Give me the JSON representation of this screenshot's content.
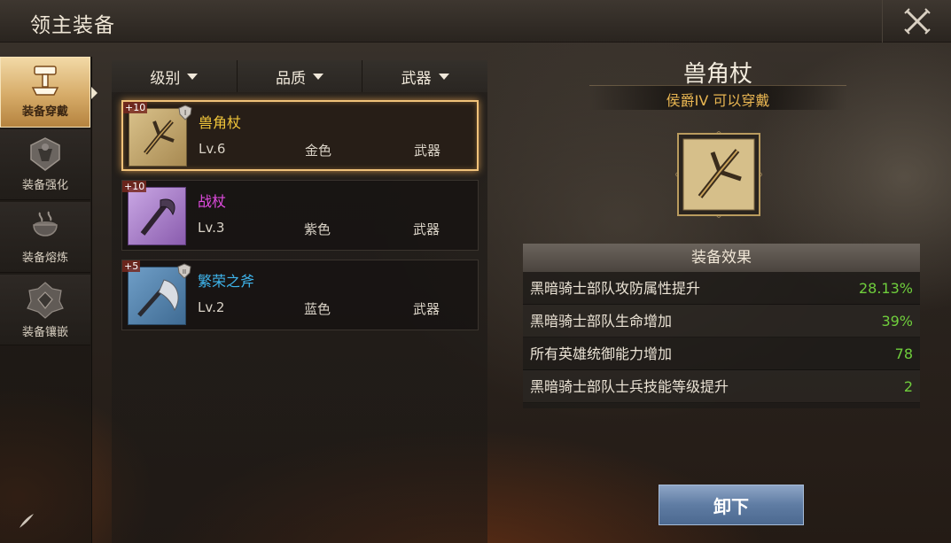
{
  "header": {
    "title": "领主装备"
  },
  "sidebar": {
    "items": [
      {
        "label": "装备穿戴",
        "icon": "anvil-hammer-icon",
        "active": true
      },
      {
        "label": "装备强化",
        "icon": "forge-emblem-icon",
        "active": false
      },
      {
        "label": "装备熔炼",
        "icon": "smelting-pot-icon",
        "active": false
      },
      {
        "label": "装备镶嵌",
        "icon": "gem-socket-icon",
        "active": false
      }
    ]
  },
  "filters": [
    {
      "label": "级别"
    },
    {
      "label": "品质"
    },
    {
      "label": "武器"
    }
  ],
  "items": [
    {
      "plus": "+10",
      "name": "兽角杖",
      "level": "Lv.6",
      "quality": "金色",
      "type": "武器",
      "rank_badge": "I",
      "name_color": "#f0c53a",
      "frame": "gold",
      "selected": true
    },
    {
      "plus": "+10",
      "name": "战杖",
      "level": "Lv.3",
      "quality": "紫色",
      "type": "武器",
      "rank_badge": "",
      "name_color": "#e04be0",
      "frame": "purple",
      "selected": false
    },
    {
      "plus": "+5",
      "name": "繁荣之斧",
      "level": "Lv.2",
      "quality": "蓝色",
      "type": "武器",
      "rank_badge": "II",
      "name_color": "#3fb6ee",
      "frame": "blue",
      "selected": false
    }
  ],
  "detail": {
    "name": "兽角杖",
    "requirement": "侯爵IV 可以穿戴",
    "effects_title": "装备效果",
    "effects": [
      {
        "text": "黑暗骑士部队攻防属性提升",
        "value": "28.13%"
      },
      {
        "text": "黑暗骑士部队生命增加",
        "value": "39%"
      },
      {
        "text": "所有英雄统御能力增加",
        "value": "78"
      },
      {
        "text": "黑暗骑士部队士兵技能等级提升",
        "value": "2"
      }
    ],
    "unequip_label": "卸下"
  },
  "colors": {
    "accent_gold": "#e9b652",
    "effect_green": "#6fce3c",
    "button_blue": "#5f7ca3"
  }
}
